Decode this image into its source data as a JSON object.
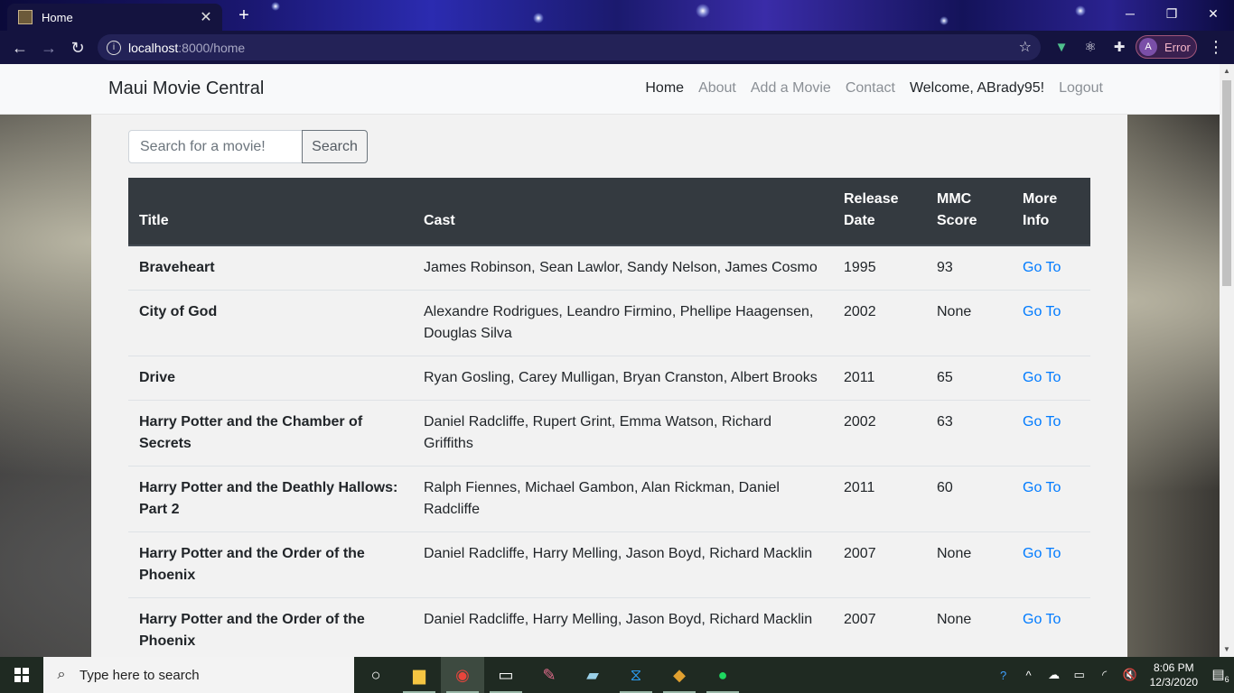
{
  "browser": {
    "tab_title": "Home",
    "tab_close": "✕",
    "new_tab": "+",
    "url_host": "localhost",
    "url_path": ":8000/home",
    "profile_initial": "A",
    "profile_status": "Error",
    "window_controls": [
      "─",
      "❐",
      "✕"
    ]
  },
  "navbar": {
    "brand": "Maui Movie Central",
    "links": {
      "home": "Home",
      "about": "About",
      "add": "Add a Movie",
      "contact": "Contact",
      "welcome": "Welcome, ABrady95!",
      "logout": "Logout"
    }
  },
  "search": {
    "placeholder": "Search for a movie!",
    "button": "Search"
  },
  "table": {
    "headers": {
      "title": "Title",
      "cast": "Cast",
      "release": "Release Date",
      "score": "MMC Score",
      "info": "More Info"
    },
    "rows": [
      {
        "title": "Braveheart",
        "cast": "James Robinson, Sean Lawlor, Sandy Nelson, James Cosmo",
        "year": "1995",
        "score": "93",
        "link": "Go To"
      },
      {
        "title": "City of God",
        "cast": "Alexandre Rodrigues, Leandro Firmino, Phellipe Haagensen, Douglas Silva",
        "year": "2002",
        "score": "None",
        "link": "Go To"
      },
      {
        "title": "Drive",
        "cast": "Ryan Gosling, Carey Mulligan, Bryan Cranston, Albert Brooks",
        "year": "2011",
        "score": "65",
        "link": "Go To"
      },
      {
        "title": "Harry Potter and the Chamber of Secrets",
        "cast": "Daniel Radcliffe, Rupert Grint, Emma Watson, Richard Griffiths",
        "year": "2002",
        "score": "63",
        "link": "Go To"
      },
      {
        "title": "Harry Potter and the Deathly Hallows: Part 2",
        "cast": "Ralph Fiennes, Michael Gambon, Alan Rickman, Daniel Radcliffe",
        "year": "2011",
        "score": "60",
        "link": "Go To"
      },
      {
        "title": "Harry Potter and the Order of the Phoenix",
        "cast": "Daniel Radcliffe, Harry Melling, Jason Boyd, Richard Macklin",
        "year": "2007",
        "score": "None",
        "link": "Go To"
      },
      {
        "title": "Harry Potter and the Order of the Phoenix",
        "cast": "Daniel Radcliffe, Harry Melling, Jason Boyd, Richard Macklin",
        "year": "2007",
        "score": "None",
        "link": "Go To"
      }
    ]
  },
  "taskbar": {
    "search_placeholder": "Type here to search",
    "time": "8:06 PM",
    "date": "12/3/2020",
    "notification_count": "6"
  },
  "colors": {
    "link": "#007bff",
    "table_header": "#343a40",
    "navbar_bg": "#f8f9fa"
  },
  "icons": [
    "back-icon",
    "forward-icon",
    "reload-icon",
    "info-icon",
    "bookmark-star-icon",
    "vue-devtools-icon",
    "react-devtools-icon",
    "extensions-icon",
    "menu-icon",
    "windows-icon",
    "search-icon",
    "cortana-icon",
    "file-explorer-icon",
    "chrome-icon",
    "terminal-icon",
    "paint-icon",
    "notes-icon",
    "vscode-icon",
    "git-icon",
    "spotify-icon",
    "help-icon",
    "network-icon",
    "battery-icon",
    "volume-icon",
    "notification-icon"
  ]
}
